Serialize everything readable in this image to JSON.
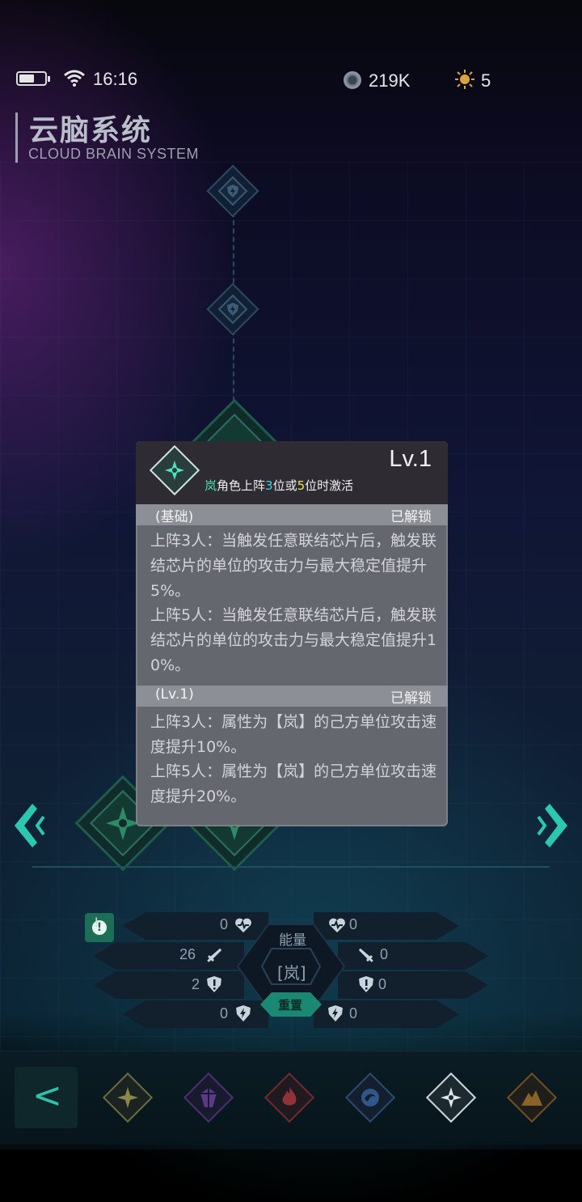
{
  "status_bar": {
    "time": "16:16",
    "battery_level": 0.6,
    "currency_amount": "219K",
    "star_amount": "5"
  },
  "header": {
    "title": "云脑系统",
    "subtitle": "CLOUD BRAIN SYSTEM"
  },
  "popup": {
    "level": "Lv.1",
    "condition": {
      "element": "岚",
      "part1": "角色上阵",
      "n1": "3",
      "part2": "位或",
      "n2": "5",
      "part3": "位时激活"
    },
    "sections": [
      {
        "tag": "(基础)",
        "state": "已解锁",
        "lines": [
          "上阵3人：当触发任意联结芯片后，触发联结芯片的单位的攻击力与最大稳定值提升5%。",
          "上阵5人：当触发任意联结芯片后，触发联结芯片的单位的攻击力与最大稳定值提升10%。"
        ]
      },
      {
        "tag": "(Lv.1)",
        "state": "已解锁",
        "lines": [
          "上阵3人：属性为【岚】的己方单位攻击速度提升10%。",
          "上阵5人：属性为【岚】的己方单位攻击速度提升20%。"
        ]
      }
    ]
  },
  "stats": {
    "energy_label": "能量",
    "element_label": "[岚]",
    "reset_label": "重置",
    "left": [
      {
        "value": "0",
        "icon": "heart-pulse-icon"
      },
      {
        "value": "26",
        "icon": "sword-icon"
      },
      {
        "value": "2",
        "icon": "shield-icon"
      },
      {
        "value": "0",
        "icon": "lightning-shield-icon"
      }
    ],
    "right": [
      {
        "value": "0",
        "icon": "heart-pulse-icon"
      },
      {
        "value": "0",
        "icon": "sword-icon"
      },
      {
        "value": "0",
        "icon": "shield-icon"
      },
      {
        "value": "0",
        "icon": "lightning-shield-icon"
      }
    ]
  },
  "bottom_bar": {
    "back_label": "<",
    "categories": [
      {
        "name": "light",
        "color": "#6b6a3f",
        "icon": "sparkle-icon"
      },
      {
        "name": "void",
        "color": "#4b2f6e",
        "icon": "crystal-icon"
      },
      {
        "name": "fire",
        "color": "#6e2a2f",
        "icon": "flame-icon"
      },
      {
        "name": "water",
        "color": "#2b4a6e",
        "icon": "wave-icon"
      },
      {
        "name": "wind",
        "color": "#cfd6dc",
        "icon": "shuriken-icon"
      },
      {
        "name": "earth",
        "color": "#6e5020",
        "icon": "mountain-icon"
      }
    ]
  }
}
